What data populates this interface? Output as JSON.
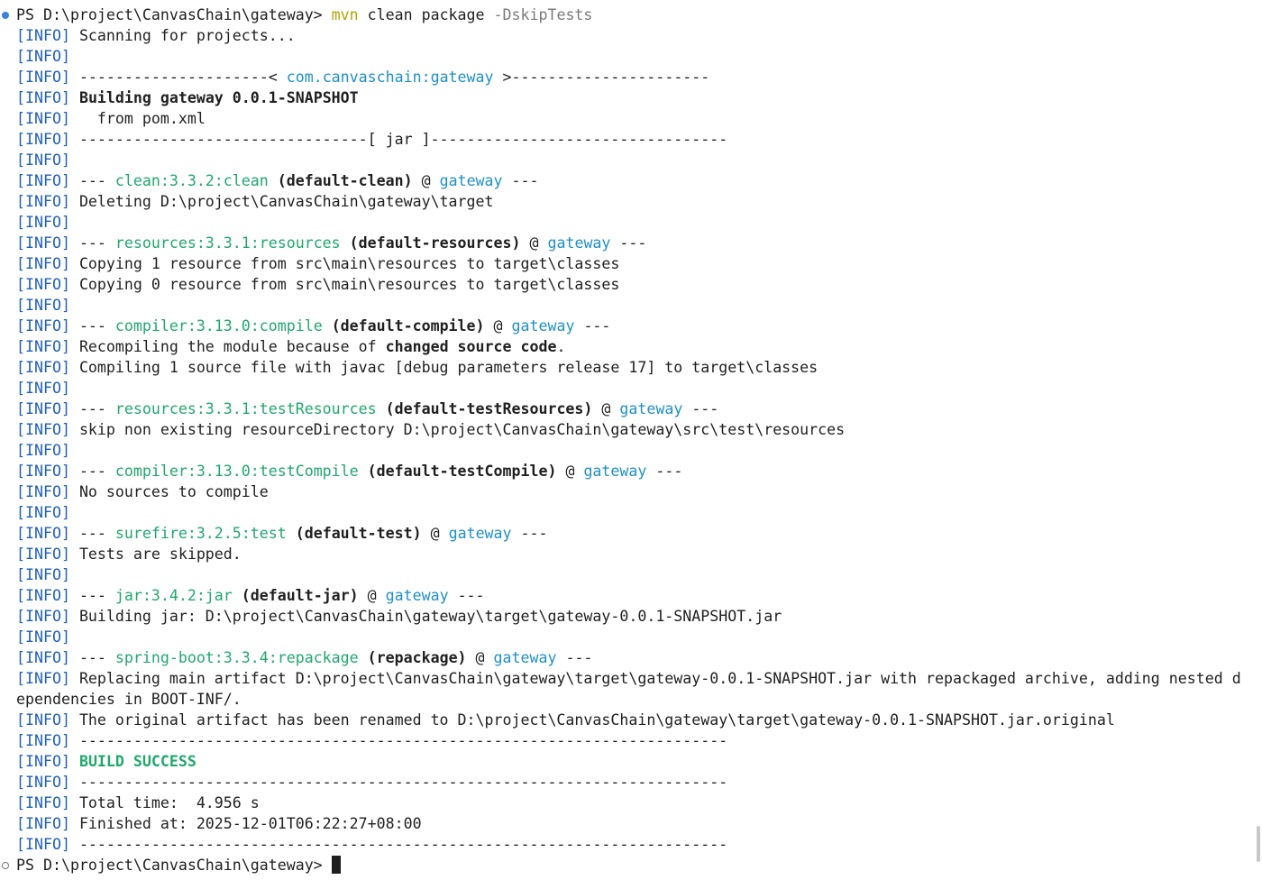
{
  "colors": {
    "background": "#ffffff",
    "text": "#1f1f1f",
    "info_tag": "#1f5fbf",
    "command": "#b8a000",
    "flag": "#7a7a7a",
    "plugin": "#1fa86c",
    "project": "#1e90c8",
    "success": "#1fa86c"
  },
  "icons": {
    "prompt_marker_top": "filled-circle-icon",
    "prompt_marker_bottom": "hollow-circle-icon"
  },
  "lines": [
    [
      {
        "t": "PS D:\\project\\CanvasChain\\gateway> "
      },
      {
        "t": "mvn",
        "c": "cmd"
      },
      {
        "t": " clean package "
      },
      {
        "t": "-DskipTests",
        "c": "flag"
      }
    ],
    [
      {
        "t": "[INFO]",
        "c": "info"
      },
      {
        "t": " Scanning for projects..."
      }
    ],
    [
      {
        "t": "[INFO]",
        "c": "info"
      }
    ],
    [
      {
        "t": "[INFO]",
        "c": "info"
      },
      {
        "t": " ---------------------< "
      },
      {
        "t": "com.canvaschain:gateway",
        "c": "proj"
      },
      {
        "t": " >----------------------"
      }
    ],
    [
      {
        "t": "[INFO]",
        "c": "info"
      },
      {
        "t": " "
      },
      {
        "t": "Building gateway 0.0.1-SNAPSHOT",
        "c": "b"
      }
    ],
    [
      {
        "t": "[INFO]",
        "c": "info"
      },
      {
        "t": "   from pom.xml"
      }
    ],
    [
      {
        "t": "[INFO]",
        "c": "info"
      },
      {
        "t": " --------------------------------[ jar ]---------------------------------"
      }
    ],
    [
      {
        "t": "[INFO]",
        "c": "info"
      }
    ],
    [
      {
        "t": "[INFO]",
        "c": "info"
      },
      {
        "t": " --- "
      },
      {
        "t": "clean:3.3.2:clean",
        "c": "plugin"
      },
      {
        "t": " "
      },
      {
        "t": "(default-clean)",
        "c": "b"
      },
      {
        "t": " @ "
      },
      {
        "t": "gateway",
        "c": "proj"
      },
      {
        "t": " ---"
      }
    ],
    [
      {
        "t": "[INFO]",
        "c": "info"
      },
      {
        "t": " Deleting D:\\project\\CanvasChain\\gateway\\target"
      }
    ],
    [
      {
        "t": "[INFO]",
        "c": "info"
      }
    ],
    [
      {
        "t": "[INFO]",
        "c": "info"
      },
      {
        "t": " --- "
      },
      {
        "t": "resources:3.3.1:resources",
        "c": "plugin"
      },
      {
        "t": " "
      },
      {
        "t": "(default-resources)",
        "c": "b"
      },
      {
        "t": " @ "
      },
      {
        "t": "gateway",
        "c": "proj"
      },
      {
        "t": " ---"
      }
    ],
    [
      {
        "t": "[INFO]",
        "c": "info"
      },
      {
        "t": " Copying 1 resource from src\\main\\resources to target\\classes"
      }
    ],
    [
      {
        "t": "[INFO]",
        "c": "info"
      },
      {
        "t": " Copying 0 resource from src\\main\\resources to target\\classes"
      }
    ],
    [
      {
        "t": "[INFO]",
        "c": "info"
      }
    ],
    [
      {
        "t": "[INFO]",
        "c": "info"
      },
      {
        "t": " --- "
      },
      {
        "t": "compiler:3.13.0:compile",
        "c": "plugin"
      },
      {
        "t": " "
      },
      {
        "t": "(default-compile)",
        "c": "b"
      },
      {
        "t": " @ "
      },
      {
        "t": "gateway",
        "c": "proj"
      },
      {
        "t": " ---"
      }
    ],
    [
      {
        "t": "[INFO]",
        "c": "info"
      },
      {
        "t": " Recompiling the module because of "
      },
      {
        "t": "changed source code",
        "c": "b"
      },
      {
        "t": "."
      }
    ],
    [
      {
        "t": "[INFO]",
        "c": "info"
      },
      {
        "t": " Compiling 1 source file with javac [debug parameters release 17] to target\\classes"
      }
    ],
    [
      {
        "t": "[INFO]",
        "c": "info"
      }
    ],
    [
      {
        "t": "[INFO]",
        "c": "info"
      },
      {
        "t": " --- "
      },
      {
        "t": "resources:3.3.1:testResources",
        "c": "plugin"
      },
      {
        "t": " "
      },
      {
        "t": "(default-testResources)",
        "c": "b"
      },
      {
        "t": " @ "
      },
      {
        "t": "gateway",
        "c": "proj"
      },
      {
        "t": " ---"
      }
    ],
    [
      {
        "t": "[INFO]",
        "c": "info"
      },
      {
        "t": " skip non existing resourceDirectory D:\\project\\CanvasChain\\gateway\\src\\test\\resources"
      }
    ],
    [
      {
        "t": "[INFO]",
        "c": "info"
      }
    ],
    [
      {
        "t": "[INFO]",
        "c": "info"
      },
      {
        "t": " --- "
      },
      {
        "t": "compiler:3.13.0:testCompile",
        "c": "plugin"
      },
      {
        "t": " "
      },
      {
        "t": "(default-testCompile)",
        "c": "b"
      },
      {
        "t": " @ "
      },
      {
        "t": "gateway",
        "c": "proj"
      },
      {
        "t": " ---"
      }
    ],
    [
      {
        "t": "[INFO]",
        "c": "info"
      },
      {
        "t": " No sources to compile"
      }
    ],
    [
      {
        "t": "[INFO]",
        "c": "info"
      }
    ],
    [
      {
        "t": "[INFO]",
        "c": "info"
      },
      {
        "t": " --- "
      },
      {
        "t": "surefire:3.2.5:test",
        "c": "plugin"
      },
      {
        "t": " "
      },
      {
        "t": "(default-test)",
        "c": "b"
      },
      {
        "t": " @ "
      },
      {
        "t": "gateway",
        "c": "proj"
      },
      {
        "t": " ---"
      }
    ],
    [
      {
        "t": "[INFO]",
        "c": "info"
      },
      {
        "t": " Tests are skipped."
      }
    ],
    [
      {
        "t": "[INFO]",
        "c": "info"
      }
    ],
    [
      {
        "t": "[INFO]",
        "c": "info"
      },
      {
        "t": " --- "
      },
      {
        "t": "jar:3.4.2:jar",
        "c": "plugin"
      },
      {
        "t": " "
      },
      {
        "t": "(default-jar)",
        "c": "b"
      },
      {
        "t": " @ "
      },
      {
        "t": "gateway",
        "c": "proj"
      },
      {
        "t": " ---"
      }
    ],
    [
      {
        "t": "[INFO]",
        "c": "info"
      },
      {
        "t": " Building jar: D:\\project\\CanvasChain\\gateway\\target\\gateway-0.0.1-SNAPSHOT.jar"
      }
    ],
    [
      {
        "t": "[INFO]",
        "c": "info"
      }
    ],
    [
      {
        "t": "[INFO]",
        "c": "info"
      },
      {
        "t": " --- "
      },
      {
        "t": "spring-boot:3.3.4:repackage",
        "c": "plugin"
      },
      {
        "t": " "
      },
      {
        "t": "(repackage)",
        "c": "b"
      },
      {
        "t": " @ "
      },
      {
        "t": "gateway",
        "c": "proj"
      },
      {
        "t": " ---"
      }
    ],
    [
      {
        "t": "[INFO]",
        "c": "info"
      },
      {
        "t": " Replacing main artifact D:\\project\\CanvasChain\\gateway\\target\\gateway-0.0.1-SNAPSHOT.jar with repackaged archive, adding nested d"
      }
    ],
    [
      {
        "t": "ependencies in BOOT-INF/."
      }
    ],
    [
      {
        "t": "[INFO]",
        "c": "info"
      },
      {
        "t": " The original artifact has been renamed to D:\\project\\CanvasChain\\gateway\\target\\gateway-0.0.1-SNAPSHOT.jar.original"
      }
    ],
    [
      {
        "t": "[INFO]",
        "c": "info"
      },
      {
        "t": " ------------------------------------------------------------------------"
      }
    ],
    [
      {
        "t": "[INFO]",
        "c": "info"
      },
      {
        "t": " "
      },
      {
        "t": "BUILD SUCCESS",
        "c": "success"
      }
    ],
    [
      {
        "t": "[INFO]",
        "c": "info"
      },
      {
        "t": " ------------------------------------------------------------------------"
      }
    ],
    [
      {
        "t": "[INFO]",
        "c": "info"
      },
      {
        "t": " Total time:  4.956 s"
      }
    ],
    [
      {
        "t": "[INFO]",
        "c": "info"
      },
      {
        "t": " Finished at: 2025-12-01T06:22:27+08:00"
      }
    ],
    [
      {
        "t": "[INFO]",
        "c": "info"
      },
      {
        "t": " ------------------------------------------------------------------------"
      }
    ],
    [
      {
        "t": "PS D:\\project\\CanvasChain\\gateway> "
      }
    ]
  ]
}
